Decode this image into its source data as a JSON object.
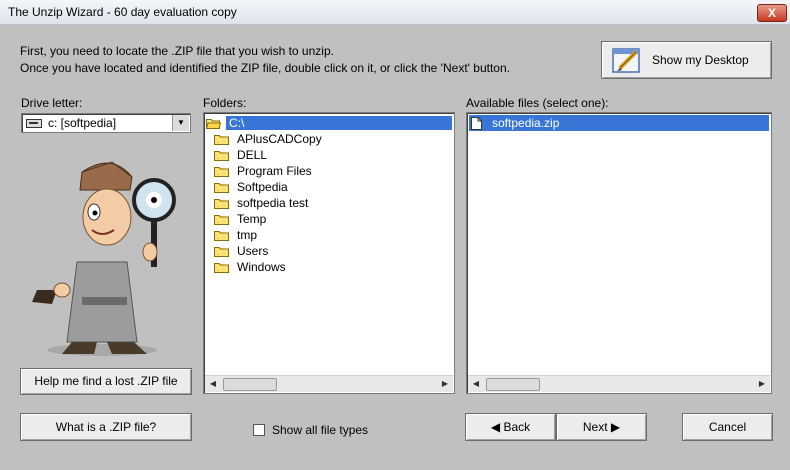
{
  "window": {
    "title": "The Unzip Wizard - 60 day evaluation copy",
    "close_glyph": "X"
  },
  "instructions": {
    "line1": "First, you need to locate the .ZIP file that you wish to unzip.",
    "line2": "Once you have located and identified the ZIP file, double click on it, or click the 'Next' button."
  },
  "desktop_button": {
    "label": "Show my Desktop"
  },
  "drive": {
    "label": "Drive letter:",
    "value": "c: [softpedia]"
  },
  "folders": {
    "label": "Folders:",
    "root": "C:\\",
    "items": [
      "APlusCADCopy",
      "DELL",
      "Program Files",
      "Softpedia",
      "softpedia test",
      "Temp",
      "tmp",
      "Users",
      "Windows"
    ]
  },
  "files": {
    "label": "Available files (select one):",
    "items": [
      "softpedia.zip"
    ]
  },
  "buttons": {
    "help": "Help me find a lost .ZIP file",
    "what_is_zip": "What is a .ZIP file?",
    "back": "Back",
    "next": "Next",
    "cancel": "Cancel"
  },
  "show_all": {
    "label": "Show all file types",
    "checked": false
  },
  "colors": {
    "selection": "#3875d7",
    "window_bg": "#c0c0c0"
  }
}
